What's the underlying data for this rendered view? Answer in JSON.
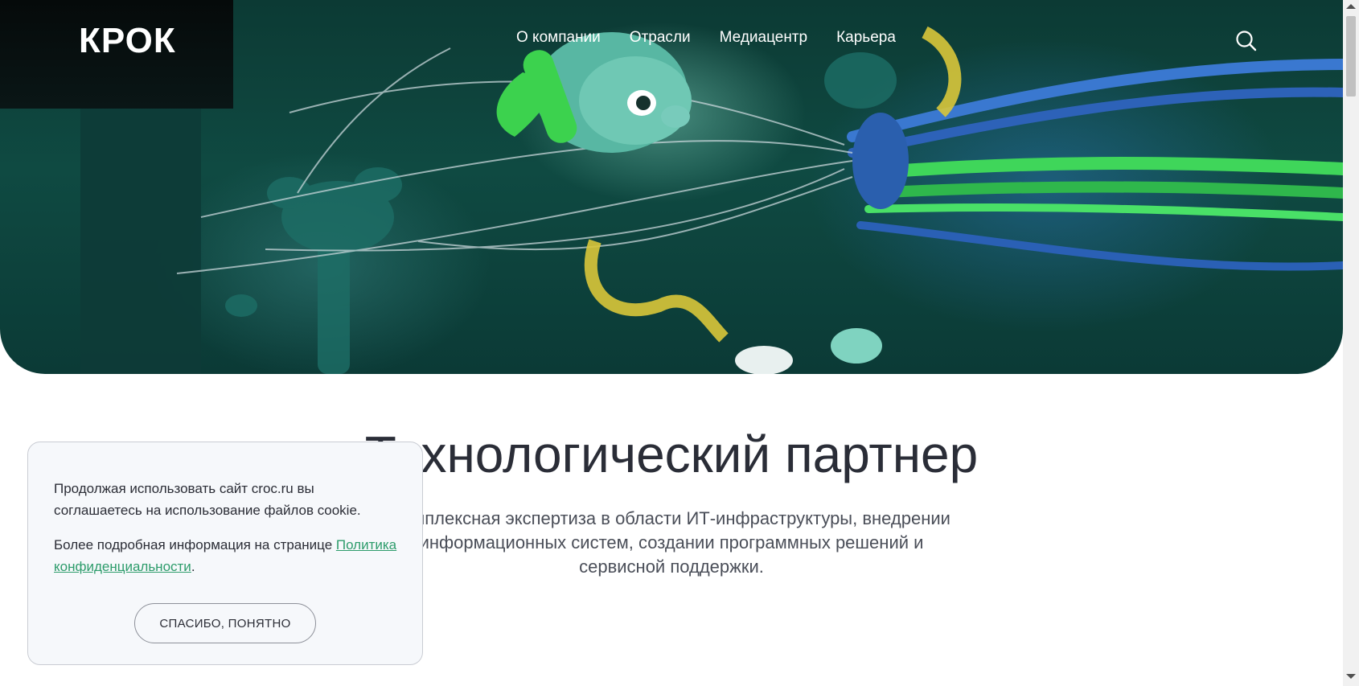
{
  "header": {
    "logo": "КРОК",
    "nav": [
      "О компании",
      "Отрасли",
      "Медиацентр",
      "Карьера"
    ],
    "search_icon": "search-icon"
  },
  "hero": {
    "image": "underwater-fish-cables-illustration"
  },
  "main": {
    "headline": "Технологический партнер",
    "subline": "Комплексная экспертиза в области ИТ-инфраструктуры, внедрении информационных систем, создании программных решений и сервисной поддержки."
  },
  "cookie": {
    "text1": "Продолжая использовать сайт croc.ru вы соглашаетесь на использование файлов cookie.",
    "text2_prefix": "Более подробная информация на странице ",
    "link": "Политика конфиденциальности",
    "text2_suffix": ".",
    "button": "СПАСИБО, ПОНЯТНО"
  },
  "colors": {
    "accent": "#2d9c6b",
    "hero_bg": "#0f4a42",
    "text": "#2a2d37"
  }
}
